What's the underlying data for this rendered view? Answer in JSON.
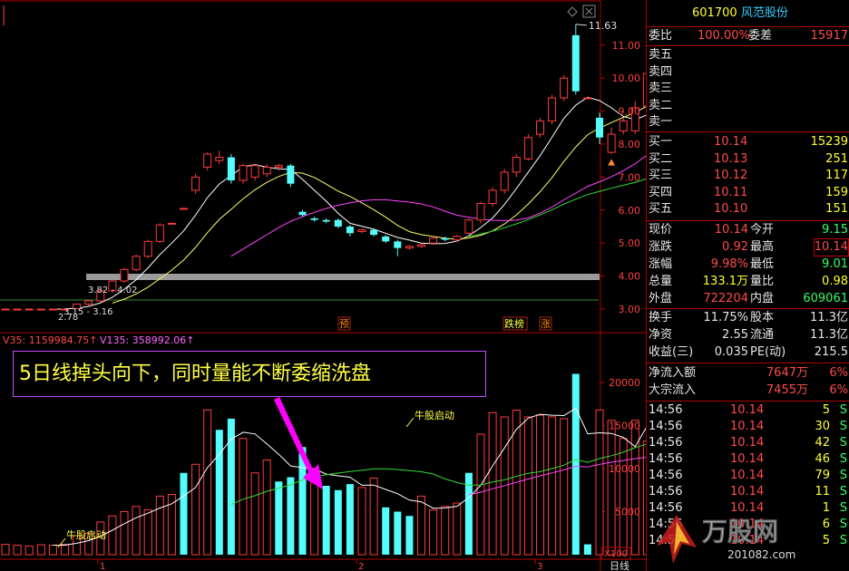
{
  "stock": {
    "code": "601700",
    "name": "风范股份"
  },
  "chart": {
    "peak_label": "11.63",
    "low_label": "2.78",
    "range1": "3.15 - 3.16",
    "range2": "3.82 - 4.02",
    "price_axis": [
      "11.00",
      "10.00",
      "9.00",
      "8.00",
      "7.00",
      "6.00",
      "5.00",
      "4.00",
      "3.00"
    ],
    "event_labels": [
      "预",
      "跌榜",
      "涨"
    ],
    "vol_ind1": "V35: 1159984.75↑",
    "vol_ind2": "V135: 358992.06↑",
    "vol_axis": [
      "20000",
      "15000",
      "10000",
      "5000"
    ],
    "vol_unit": "X100",
    "x_labels": [
      "1",
      "2",
      "3"
    ],
    "period": "日线",
    "annotation": "5日线掉头向下，同时量能不断委缩洗盘",
    "callout1": "牛股启动",
    "callout2": "牛股启动",
    "colors": {
      "up": "#ff3c3c",
      "down": "#54fcfc",
      "ma5": "#ffffff",
      "ma10": "#ffff66",
      "ma20": "#ff44ff",
      "ma60": "#33dd33",
      "accent": "#ff00ff"
    }
  },
  "quote": {
    "wei_bi_label": "委比",
    "wei_bi": "100.00%",
    "wei_cha_label": "委差",
    "wei_cha": "15917",
    "sell": [
      {
        "label": "卖五",
        "price": "",
        "vol": ""
      },
      {
        "label": "卖四",
        "price": "",
        "vol": ""
      },
      {
        "label": "卖三",
        "price": "",
        "vol": ""
      },
      {
        "label": "卖二",
        "price": "",
        "vol": ""
      },
      {
        "label": "卖一",
        "price": "",
        "vol": ""
      }
    ],
    "buy": [
      {
        "label": "买一",
        "price": "10.14",
        "vol": "15239"
      },
      {
        "label": "买二",
        "price": "10.13",
        "vol": "251"
      },
      {
        "label": "买三",
        "price": "10.12",
        "vol": "117"
      },
      {
        "label": "买四",
        "price": "10.11",
        "vol": "159"
      },
      {
        "label": "买五",
        "price": "10.10",
        "vol": "151"
      }
    ],
    "stats": [
      {
        "l1": "现价",
        "v1": "10.14",
        "l2": "今开",
        "v2": "9.15"
      },
      {
        "l1": "涨跌",
        "v1": "0.92",
        "l2": "最高",
        "v2": "10.14"
      },
      {
        "l1": "涨幅",
        "v1": "9.98%",
        "l2": "最低",
        "v2": "9.01"
      },
      {
        "l1": "总量",
        "v1": "133.1万",
        "l2": "量比",
        "v2": "0.98"
      },
      {
        "l1": "外盘",
        "v1": "722204",
        "l2": "内盘",
        "v2": "609061"
      }
    ],
    "stats2": [
      {
        "l1": "换手",
        "v1": "11.75%",
        "l2": "股本",
        "v2": "11.3亿"
      },
      {
        "l1": "净资",
        "v1": "2.55",
        "l2": "流通",
        "v2": "11.3亿"
      },
      {
        "l1": "收益(三)",
        "v1": "0.035",
        "l2": "PE(动)",
        "v2": "215.5"
      }
    ],
    "flows": [
      {
        "label": "净流入额",
        "value": "7647万",
        "pct": "6%"
      },
      {
        "label": "大宗流入",
        "value": "7455万",
        "pct": "6%"
      }
    ],
    "ticks": [
      {
        "time": "14:56",
        "price": "10.14",
        "vol": "5",
        "side": "S"
      },
      {
        "time": "14:56",
        "price": "10.14",
        "vol": "30",
        "side": "S"
      },
      {
        "time": "14:56",
        "price": "10.14",
        "vol": "42",
        "side": "S"
      },
      {
        "time": "14:56",
        "price": "10.14",
        "vol": "46",
        "side": "S"
      },
      {
        "time": "14:56",
        "price": "10.14",
        "vol": "79",
        "side": "S"
      },
      {
        "time": "14:56",
        "price": "10.14",
        "vol": "11",
        "side": "S"
      },
      {
        "time": "14:56",
        "price": "10.14",
        "vol": "1",
        "side": "S"
      },
      {
        "time": "14:56",
        "price": "10.14",
        "vol": "6",
        "side": "S"
      },
      {
        "time": "14:57",
        "price": "10.14",
        "vol": "5",
        "side": "S"
      }
    ]
  },
  "watermark": {
    "brand": "万股网",
    "url": "201082.com"
  }
}
